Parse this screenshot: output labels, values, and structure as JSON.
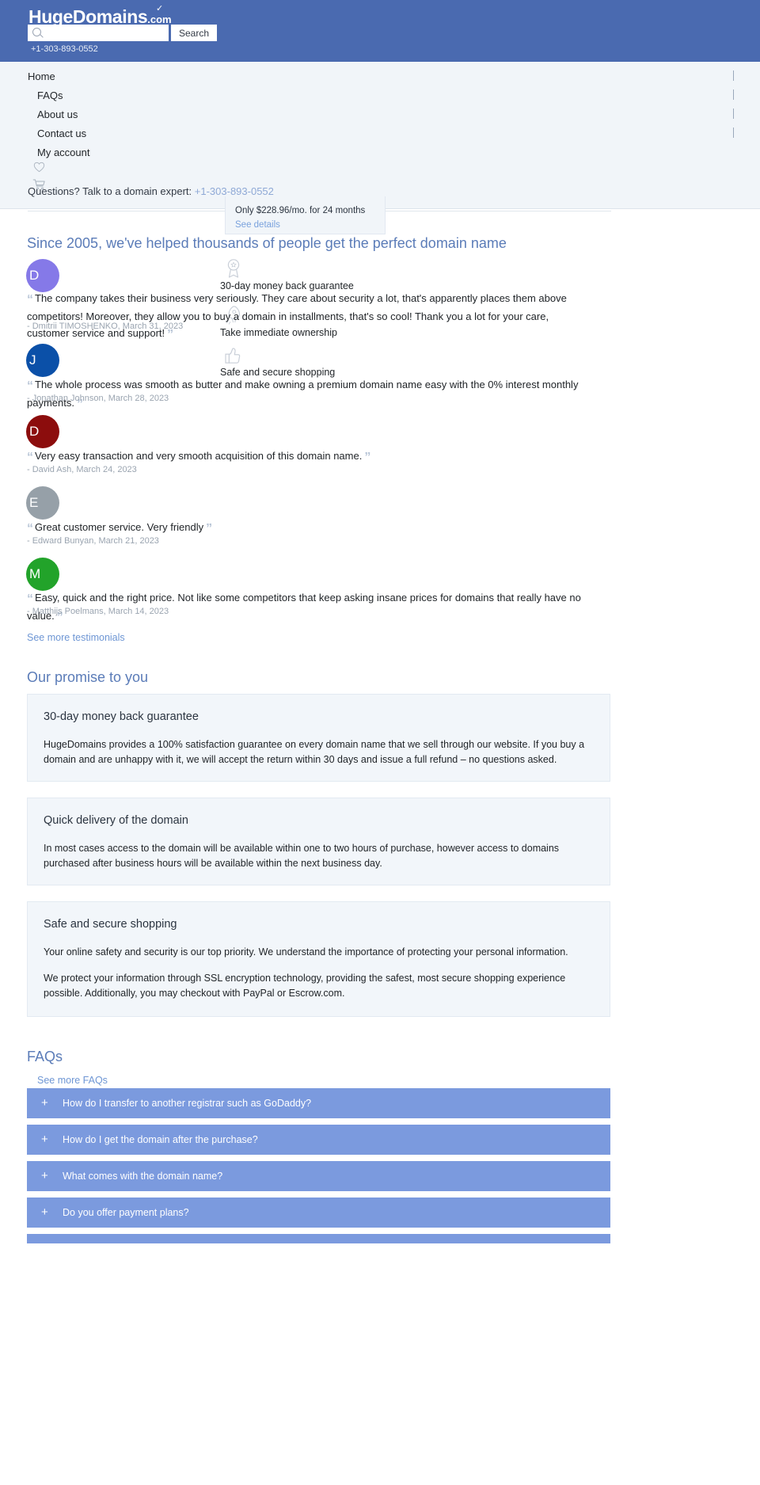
{
  "header": {
    "logo_main": "HugeDomains",
    "logo_tld": ".com",
    "search_placeholder": "",
    "search_value": "",
    "search_button": "Search",
    "phone": "+1-303-893-0552"
  },
  "nav": {
    "items": [
      {
        "label": "Home"
      },
      {
        "label": "FAQs"
      },
      {
        "label": "About us"
      },
      {
        "label": "Contact us"
      },
      {
        "label": "My account"
      }
    ],
    "icons": [
      {
        "name": "heart-icon"
      },
      {
        "name": "cart-icon"
      }
    ]
  },
  "expert": {
    "text": "Questions? Talk to a domain expert:",
    "phone": "+1-303-893-0552"
  },
  "price_popup": {
    "text": "Only $228.96/mo. for 24 months",
    "link": "See details"
  },
  "testimonials": {
    "heading": "Since 2005, we've helped thousands of people get the perfect domain name",
    "see_more": "See more testimonials",
    "items": [
      {
        "initial": "D",
        "color": "#8579e8",
        "quote": "The company takes their business very seriously. They care about security a lot, that's apparently places them above competitors! Moreover, they allow you to buy a domain in installments, that's so cool! Thank you a lot for your care, customer service and support!",
        "attrib": "- Dmitrii TIMOSHENKO, March 31, 2023"
      },
      {
        "initial": "J",
        "color": "#0b50a8",
        "quote": "The whole process was smooth as butter and make owning a premium domain name easy with the 0% interest monthly payments.",
        "attrib": "- Jonathan Johnson, March 28, 2023"
      },
      {
        "initial": "D",
        "color": "#8c0d0d",
        "quote": "Very easy transaction and very smooth acquisition of this domain name.",
        "attrib": "- David Ash, March 24, 2023"
      },
      {
        "initial": "E",
        "color": "#96a0a8",
        "quote": "Great customer service. Very friendly",
        "attrib": "- Edward Bunyan, March 21, 2023"
      },
      {
        "initial": "M",
        "color": "#22a32a",
        "quote": "Easy, quick and the right price. Not like some competitors that keep asking insane prices for domains that really have no value.",
        "attrib": "- Matthijs Poelmans, March 14, 2023"
      }
    ]
  },
  "features": [
    {
      "icon": "ribbon-award-icon",
      "label": "30-day money back guarantee"
    },
    {
      "icon": "rocket-icon",
      "label": "Take immediate ownership"
    },
    {
      "icon": "thumbs-up-icon",
      "label": "Safe and secure shopping"
    }
  ],
  "promise": {
    "heading": "Our promise to you",
    "cards": [
      {
        "title": "30-day money back guarantee",
        "paragraphs": [
          "HugeDomains provides a 100% satisfaction guarantee on every domain name that we sell through our website. If you buy a domain and are unhappy with it, we will accept the return within 30 days and issue a full refund – no questions asked."
        ]
      },
      {
        "title": "Quick delivery of the domain",
        "paragraphs": [
          "In most cases access to the domain will be available within one to two hours of purchase, however access to domains purchased after business hours will be available within the next business day."
        ]
      },
      {
        "title": "Safe and secure shopping",
        "paragraphs": [
          "Your online safety and security is our top priority. We understand the importance of protecting your personal information.",
          "We protect your information through SSL encryption technology, providing the safest, most secure shopping experience possible. Additionally, you may checkout with PayPal or Escrow.com."
        ]
      }
    ]
  },
  "faqs": {
    "heading": "FAQs",
    "see_more": "See more FAQs",
    "expand_icon": "+",
    "items": [
      {
        "question": "How do I transfer to another registrar such as GoDaddy?"
      },
      {
        "question": "How do I get the domain after the purchase?"
      },
      {
        "question": "What comes with the domain name?"
      },
      {
        "question": "Do you offer payment plans?"
      },
      {
        "question": ""
      }
    ]
  },
  "colors": {
    "header_blue": "#4a6ab0",
    "panel_light": "#f1f5f9",
    "accent_link": "#6e96d4",
    "faq_bar": "#7b9ade",
    "heading_blue": "#5b7cb8"
  }
}
